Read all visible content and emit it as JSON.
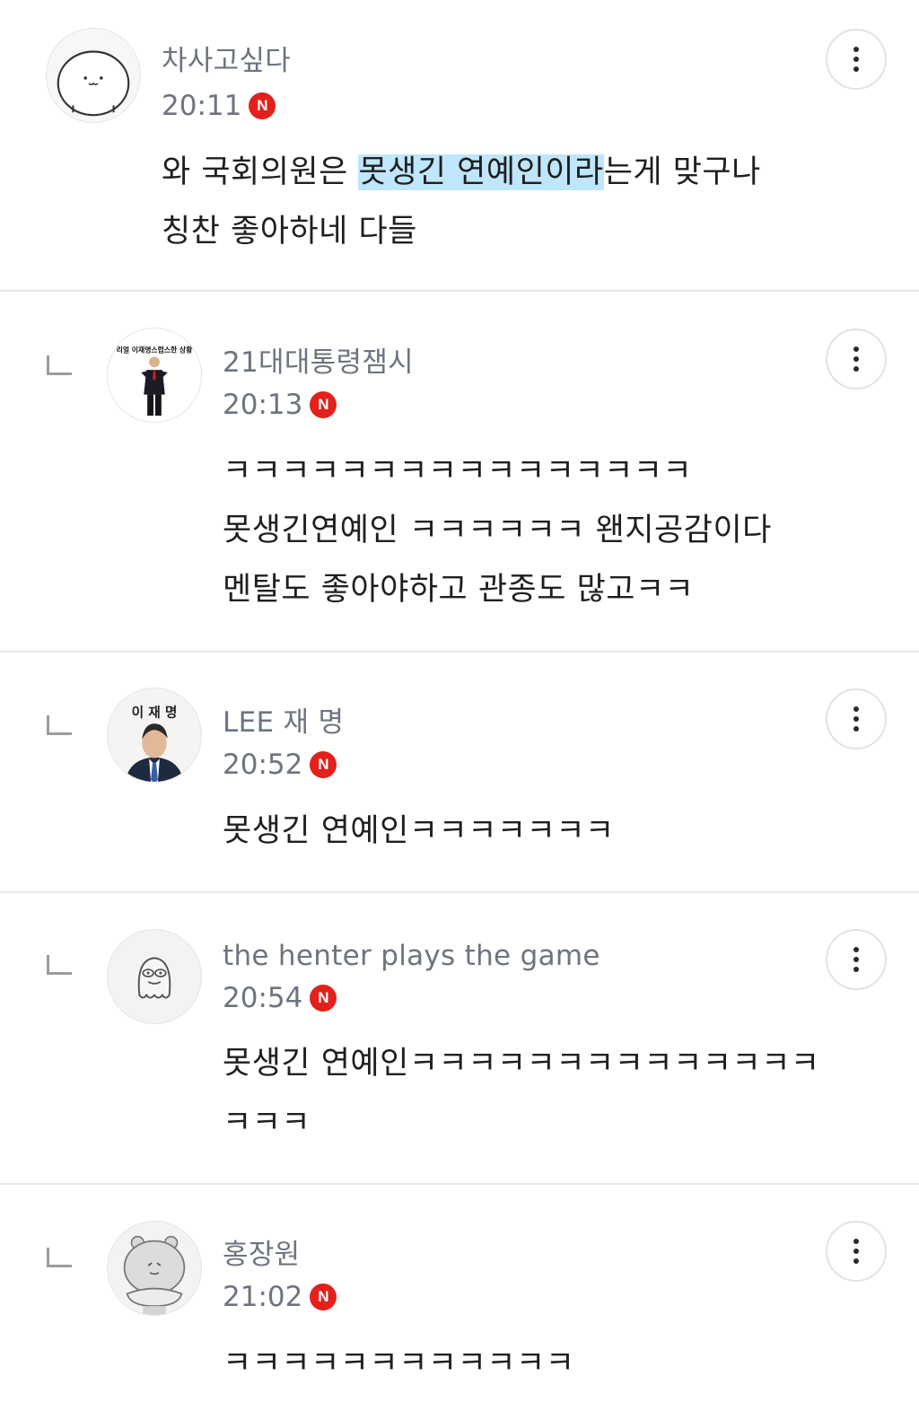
{
  "comments": [
    {
      "nickname": "차사고싶다",
      "time": "20:11",
      "badge": "N",
      "avatar_icon": "smiley-character-icon",
      "lines": [
        {
          "before": "와 국회의원은 ",
          "highlight": "못생긴 연예인이라",
          "after": "는게 맞구나"
        },
        {
          "text": "칭찬 좋아하네 다들"
        }
      ]
    },
    {
      "nickname": "21대대통령잼시",
      "time": "20:13",
      "badge": "N",
      "avatar_icon": "standing-man-photo-icon",
      "avatar_caption": "리얼 이재명스럽스한 상황",
      "lines": [
        {
          "text": "ㅋㅋㅋㅋㅋㅋㅋㅋㅋㅋㅋㅋㅋㅋㅋㅋ"
        },
        {
          "text": "못생긴연예인 ㅋㅋㅋㅋㅋㅋ 왠지공감이다"
        },
        {
          "text": "멘탈도 좋아야하고 관종도 많고ㅋㅋ"
        }
      ]
    },
    {
      "nickname": "LEE 재 명",
      "time": "20:52",
      "badge": "N",
      "avatar_icon": "portrait-photo-icon",
      "avatar_caption": "이 재 명",
      "lines": [
        {
          "text": "못생긴 연예인ㅋㅋㅋㅋㅋㅋㅋ"
        }
      ]
    },
    {
      "nickname": "the henter plays the game",
      "time": "20:54",
      "badge": "N",
      "avatar_icon": "ghost-character-icon",
      "lines": [
        {
          "text": "못생긴 연예인ㅋㅋㅋㅋㅋㅋㅋㅋㅋㅋㅋㅋㅋㅋ"
        },
        {
          "text": "ㅋㅋㅋ"
        }
      ]
    },
    {
      "nickname": "홍장원",
      "time": "21:02",
      "badge": "N",
      "avatar_icon": "hippo-character-icon",
      "lines": [
        {
          "text": "ㅋㅋㅋㅋㅋㅋㅋㅋㅋㅋㅋㅋ"
        }
      ]
    }
  ],
  "colors": {
    "nickname": "#6d7480",
    "body_text": "#1f1f1f",
    "new_badge": "#e3201b",
    "highlight": "#bfe6fb",
    "divider": "#e6e6e6"
  }
}
